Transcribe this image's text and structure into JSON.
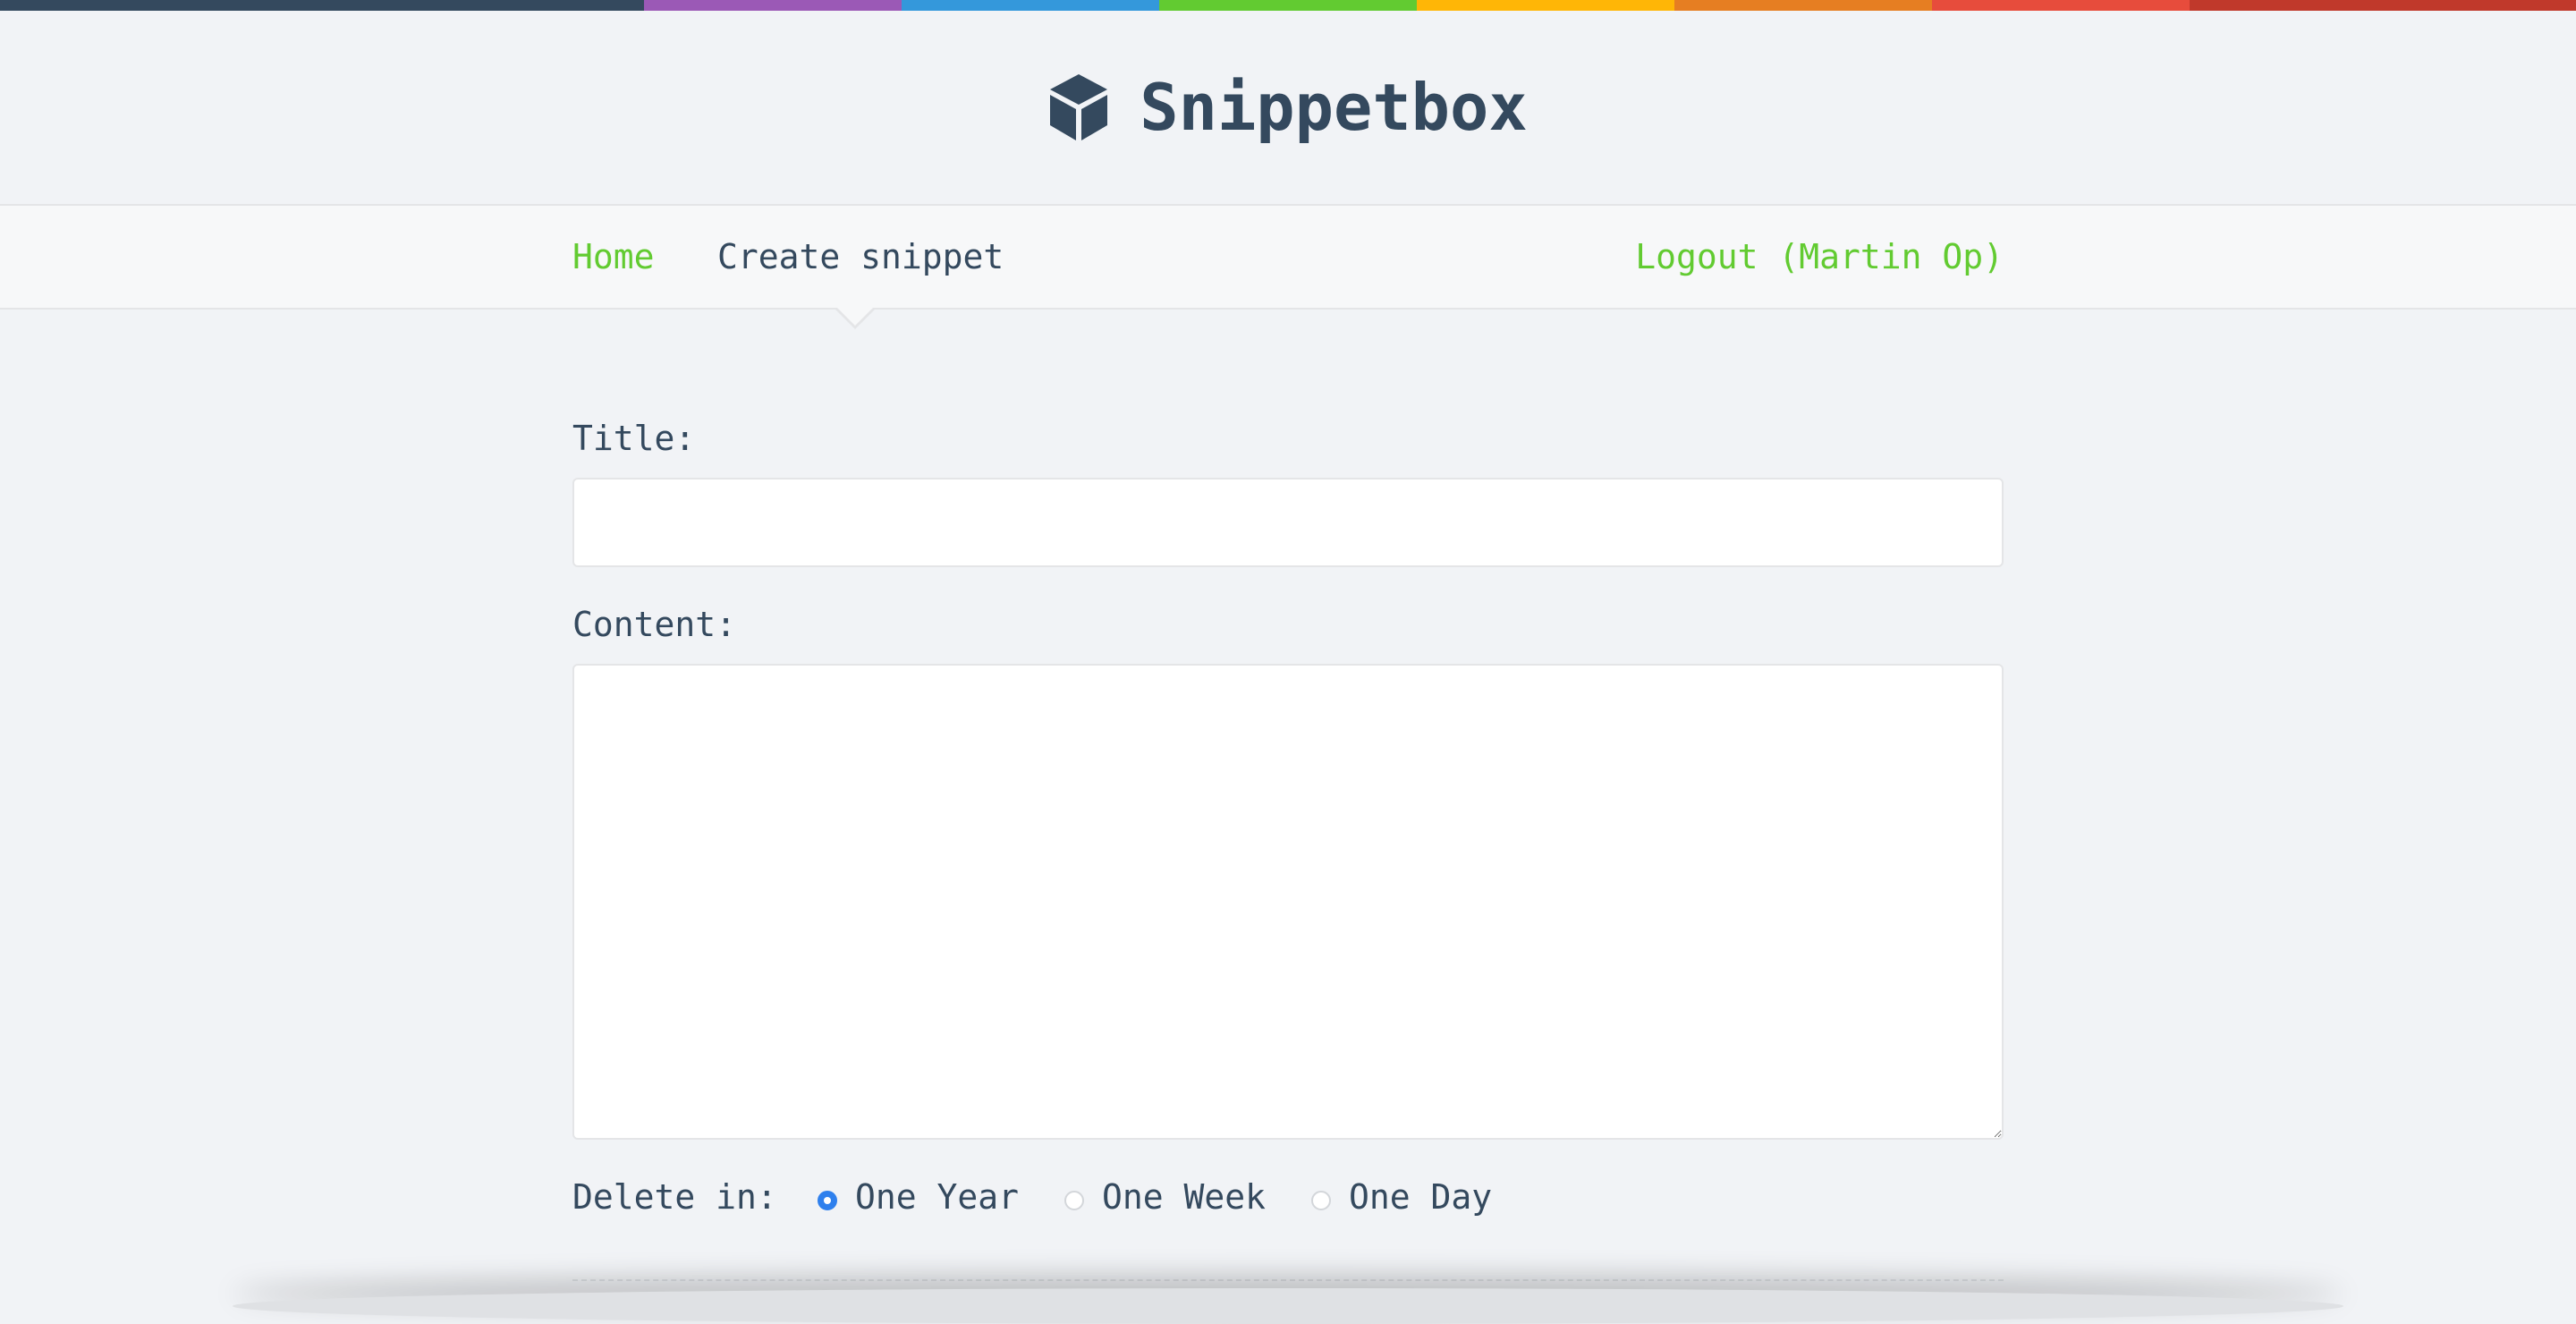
{
  "top_stripe_colors": [
    "#34495e",
    "#9b59b6",
    "#3498db",
    "#62cb31",
    "#ffb606",
    "#e67e22",
    "#e74c3c",
    "#c0392b"
  ],
  "brand": {
    "icon": "cube-icon",
    "name": "Snippetbox"
  },
  "nav": {
    "home": "Home",
    "create": "Create snippet",
    "logout": "Logout (Martin Op)"
  },
  "form": {
    "title_label": "Title:",
    "title_value": "",
    "content_label": "Content:",
    "content_value": "",
    "expires_label": "Delete in:",
    "expires_options": [
      {
        "label": "One Year",
        "checked": true
      },
      {
        "label": "One Week",
        "checked": false
      },
      {
        "label": "One Day",
        "checked": false
      }
    ]
  },
  "colors": {
    "text": "#34495e",
    "link": "#62cb31",
    "radio_selected": "#2f80ed",
    "background": "#f1f3f6"
  }
}
